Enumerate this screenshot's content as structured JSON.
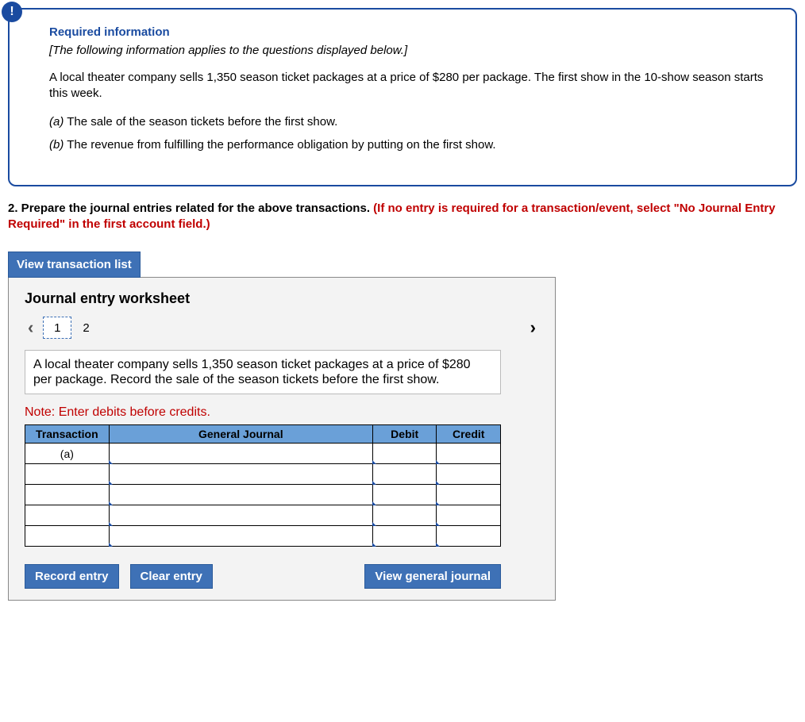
{
  "info": {
    "heading": "Required information",
    "subheading": "[The following information applies to the questions displayed below.]",
    "paragraph": "A local theater company sells 1,350 season ticket packages at a price of $280 per package. The first show in the 10-show season starts this week.",
    "items": [
      {
        "label": "(a)",
        "text": " The sale of the season tickets before the first show."
      },
      {
        "label": "(b)",
        "text": " The revenue from fulfilling the performance obligation by putting on the first show."
      }
    ]
  },
  "instruction": {
    "number": "2.",
    "black": " Prepare the journal entries related for the above transactions. ",
    "red": "(If no entry is required for a transaction/event, select \"No Journal Entry Required\" in the first account field.)"
  },
  "view_list_btn": "View transaction list",
  "worksheet": {
    "title": "Journal entry worksheet",
    "steps": [
      "1",
      "2"
    ],
    "prompt": "A local theater company sells 1,350 season ticket packages at a price of $280 per package. Record the sale of the season tickets before the first show.",
    "note": "Note: Enter debits before credits.",
    "headers": {
      "txn": "Transaction",
      "gj": "General Journal",
      "debit": "Debit",
      "credit": "Credit"
    },
    "rows": [
      {
        "txn": "(a)",
        "gj": "",
        "debit": "",
        "credit": ""
      },
      {
        "txn": "",
        "gj": "",
        "debit": "",
        "credit": ""
      },
      {
        "txn": "",
        "gj": "",
        "debit": "",
        "credit": ""
      },
      {
        "txn": "",
        "gj": "",
        "debit": "",
        "credit": ""
      },
      {
        "txn": "",
        "gj": "",
        "debit": "",
        "credit": ""
      }
    ],
    "buttons": {
      "record": "Record entry",
      "clear": "Clear entry",
      "view": "View general journal"
    }
  }
}
